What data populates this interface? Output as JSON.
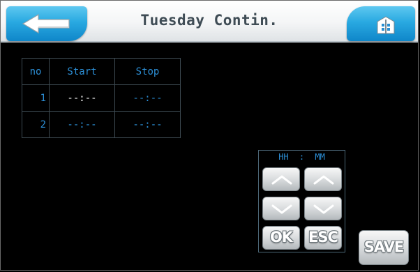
{
  "header": {
    "title": "Tuesday Contin.",
    "back_icon": "back-arrow-icon",
    "home_icon": "home-icon"
  },
  "schedule": {
    "columns": [
      "no",
      "Start",
      "Stop"
    ],
    "rows": [
      {
        "no": "1",
        "start": "--:--",
        "stop": "--:--"
      },
      {
        "no": "2",
        "start": "--:--",
        "stop": "--:--"
      }
    ]
  },
  "keypad": {
    "hours_label": "HH",
    "separator": ":",
    "minutes_label": "MM",
    "ok_label": "OK",
    "esc_label": "ESC",
    "up_icon": "chevron-up-icon",
    "down_icon": "chevron-down-icon"
  },
  "save_label": "SAVE",
  "colors": {
    "header_bg": "#f4f5f6",
    "accent_blue": "#29a9e1",
    "text_blue": "#2c8fd6",
    "title_text": "#3f4c55",
    "grid_line": "#3d4a52",
    "background": "#000000"
  }
}
